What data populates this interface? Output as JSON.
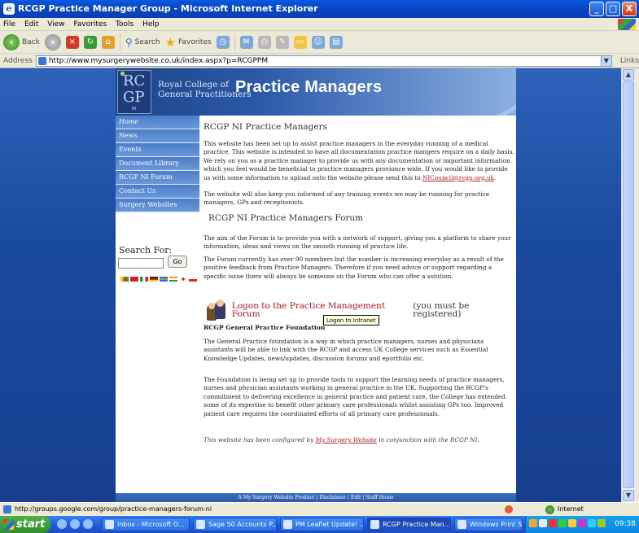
{
  "window": {
    "title": "RCGP Practice Manager Group - Microsoft Internet Explorer",
    "app_icon": "ie-icon",
    "controls": {
      "minimize": "_",
      "maximize": "□",
      "close": "X"
    }
  },
  "menubar": {
    "items": [
      "File",
      "Edit",
      "View",
      "Favorites",
      "Tools",
      "Help"
    ]
  },
  "toolbar": {
    "back": "Back",
    "search": "Search",
    "favorites": "Favorites"
  },
  "address": {
    "label": "Address",
    "url": "http://www.mysurgerywebsite.co.uk/index.aspx?p=RCGPPM",
    "links": "Links"
  },
  "banner": {
    "logo_rc": "RC",
    "logo_gp": "GP",
    "logo_ni": "NI",
    "org_line1": "Royal College of",
    "org_line2": "General Practitioners",
    "title": "Practice Managers"
  },
  "nav": {
    "items": [
      "Home",
      "News",
      "Events",
      "Document Library",
      "RCGP NI Forum",
      "Contact Us",
      "Surgery Websites"
    ]
  },
  "search": {
    "title": "Search For:",
    "value": "",
    "go_label": "Go"
  },
  "main": {
    "heading": "RCGP NI Practice Managers",
    "intro_before_link": "This website has been set up to assist practice managers in the everyday running of a medical practice. This website is intended to have all documentation practice mangers require on a daily basis. We rely on you as a practice manager to provide us with any documentation or important information which you feel would be beneficial to practice managers provionce wide. If you would like to provide us with some information to upload onto the website please send this to ",
    "intro_link": "NICouncil@rcgp.org.uk",
    "intro_after_link": ".",
    "training": "The website will also keep you informed of any training events we may be running for practice managers, GPs and receptionists.",
    "forum_heading": "RCGP NI Practice Managers Forum",
    "forum_aim": "The aim of the Forum is to provide you with a network of support, giving you a platform to share your information, ideas and views on the smooth running of practice life.",
    "forum_members": "The Forum currently has over 90 members but the number is increasing everyday as a result of the positive feedback from Practice Managers. Therefore if you need advice or support regarding a specific issue there will always be someone on the Forum who can offer a solution.",
    "forum_link": "Logon to the Practice Management Forum",
    "forum_note": "(you must be registered)",
    "tooltip": "Logon to Intranet",
    "foundation_heading": "RCGP General Practice Foundation",
    "foundation_p1": "The General Practice foundation is a way in which practice managers, nurses and physicians assistants will be able to link with the RCGP and access UK College services such as Essential Knowledge Updates, news/updates, discussion forums and eportfolio etc.",
    "foundation_p2": "The Foundation is being set up to provide tools to support the learning needs of practice managers, nurses and physician assistants working in general practice in the UK. Supporting the RCGP's commitment to delivering excellence in general practice and patient care, the College has extended some of its expertise to benefit other primary care professionals whilst assisting GPs too. Improved patient care requires the coordinated efforts of all primary care professionals.",
    "config_before": "This website has been configured by ",
    "config_link": "My Surgery Website",
    "config_after": " in conjunction with the RCGP NI."
  },
  "footer": "A My Surgery Website Product | Disclaimer | Edit | Staff Home",
  "status": {
    "text": "http://groups.google.com/group/practice-managers-forum-ni",
    "zone": "Internet"
  },
  "taskbar": {
    "start": "start",
    "tasks": [
      "Inbox - Microsoft O...",
      "Sage 50 Accounts P...",
      "PM Leaflet Update! ...",
      "RCGP Practice Man...",
      "Windows Print Scre..."
    ],
    "clock": "09:38"
  },
  "colors": {
    "banner": "#2a58a8",
    "nav": "#5a8ad0",
    "link_red": "#c0151f",
    "background": "#1d4e9e"
  }
}
